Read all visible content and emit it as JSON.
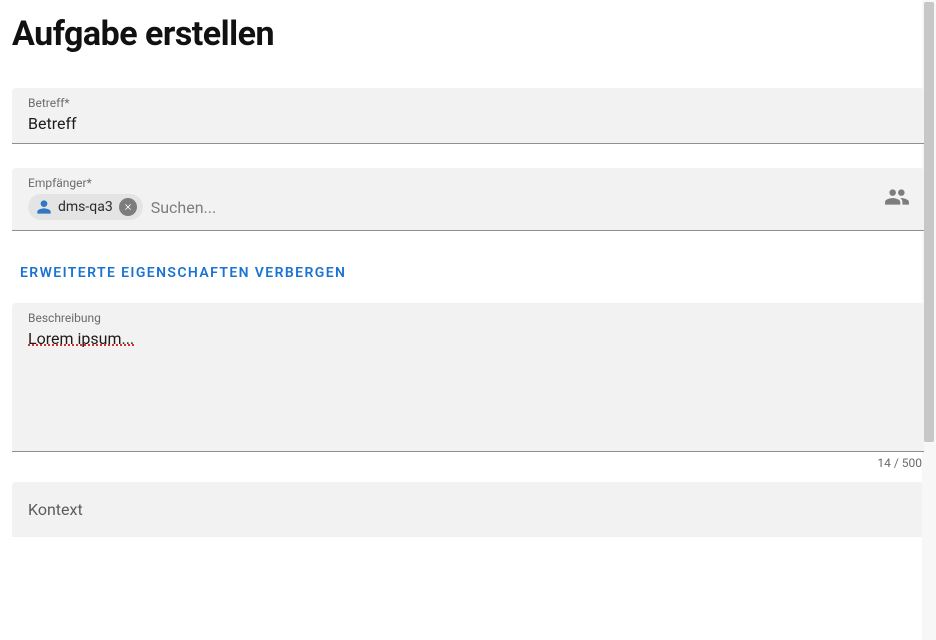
{
  "title": "Aufgabe erstellen",
  "subject": {
    "label": "Betreff*",
    "value": "Betreff"
  },
  "recipients": {
    "label": "Empfänger*",
    "chips": [
      {
        "name": "dms-qa3"
      }
    ],
    "search_placeholder": "Suchen..."
  },
  "toggle_label": "ERWEITERTE EIGENSCHAFTEN VERBERGEN",
  "description": {
    "label": "Beschreibung",
    "value": "Lorem ipsum...",
    "counter": "14 / 500"
  },
  "context": {
    "label": "Kontext"
  }
}
